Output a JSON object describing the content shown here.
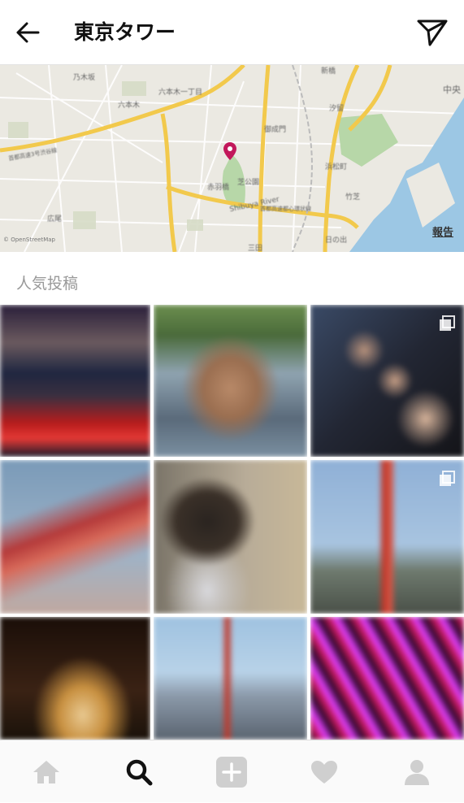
{
  "header": {
    "title": "東京タワー",
    "back_icon": "arrow-left-icon",
    "send_icon": "paper-plane-icon"
  },
  "map": {
    "labels": [
      "乃木坂",
      "六本木一丁目",
      "六本木",
      "新橋",
      "汐留",
      "御成門",
      "浜松町",
      "芝公園",
      "赤羽橋",
      "広尾",
      "三田",
      "竹芝",
      "日の出",
      "中央",
      "Shibuya River",
      "首都高速3号渋谷線",
      "首都高速都心環状線"
    ],
    "report_label": "報告",
    "attribution": "© OpenStreetMap",
    "pin_color": "#c2185b"
  },
  "section": {
    "title": "人気投稿"
  },
  "posts": [
    {
      "name": "post-karaoke",
      "multi": false
    },
    {
      "name": "post-man-shirtless",
      "multi": false
    },
    {
      "name": "post-selfie-group",
      "multi": true
    },
    {
      "name": "post-tower-closeup",
      "multi": false
    },
    {
      "name": "post-portrait",
      "multi": false
    },
    {
      "name": "post-tower-street",
      "multi": true
    },
    {
      "name": "post-tower-night-jump",
      "multi": false
    },
    {
      "name": "post-city-skyline",
      "multi": false
    },
    {
      "name": "post-neon-lights",
      "multi": false
    }
  ],
  "tabbar": {
    "tabs": [
      {
        "icon": "home-icon",
        "active": false
      },
      {
        "icon": "search-icon",
        "active": true
      },
      {
        "icon": "add-post-icon",
        "active": false
      },
      {
        "icon": "heart-icon",
        "active": false
      },
      {
        "icon": "profile-icon",
        "active": false
      }
    ]
  }
}
